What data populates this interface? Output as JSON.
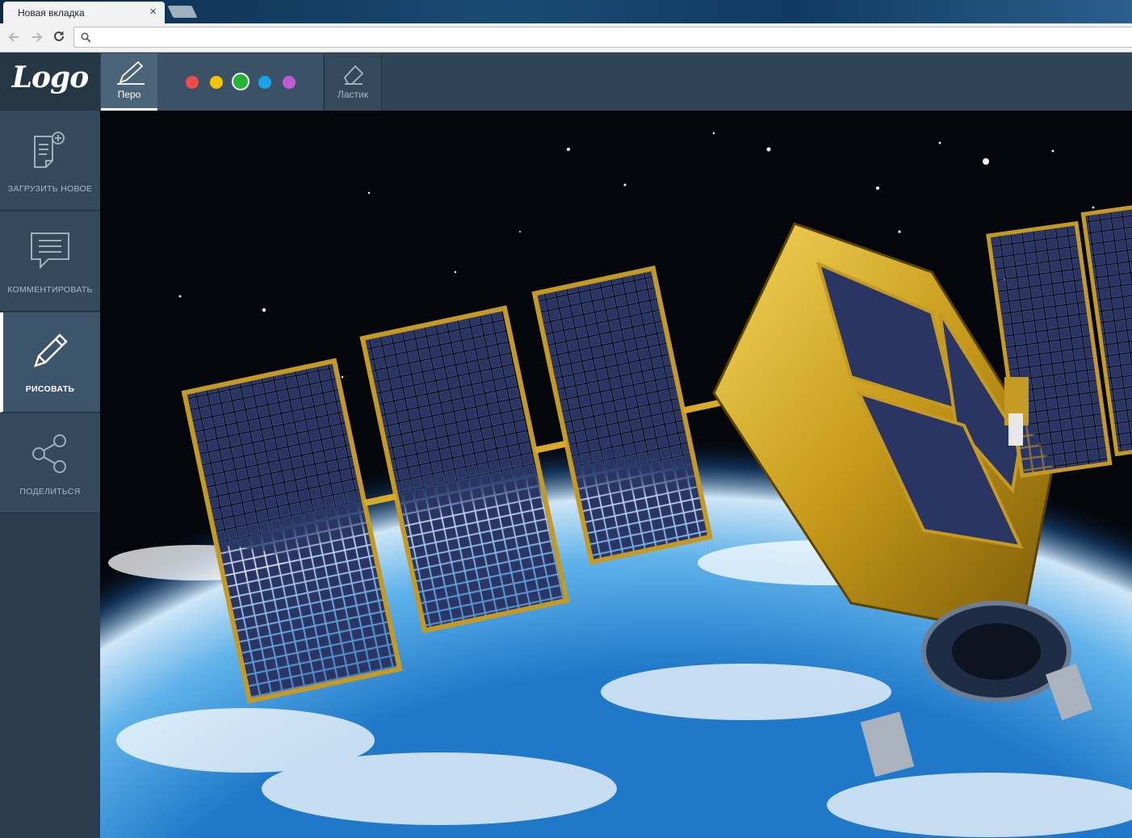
{
  "browser": {
    "tab_title": "Новая вкладка",
    "tab_close": "×",
    "address_value": "",
    "address_placeholder": ""
  },
  "app": {
    "logo_text": "Logo",
    "sidebar": {
      "items": [
        {
          "label": "ЗАГРУЗИТЬ НОВОЕ",
          "icon": "upload-document-icon",
          "active": false
        },
        {
          "label": "КОММЕНТИРОВАТЬ",
          "icon": "comment-icon",
          "active": false
        },
        {
          "label": "РИСОВАТЬ",
          "icon": "pencil-icon",
          "active": true
        },
        {
          "label": "ПОДЕЛИТЬСЯ",
          "icon": "share-icon",
          "active": false
        }
      ]
    },
    "tools": {
      "pen_label": "Перо",
      "eraser_label": "Ластик",
      "colors": [
        {
          "name": "red",
          "hex": "#f04a4a",
          "selected": false
        },
        {
          "name": "yellow",
          "hex": "#f5c400",
          "selected": false
        },
        {
          "name": "green",
          "hex": "#22b52f",
          "selected": true
        },
        {
          "name": "blue",
          "hex": "#1aa3e8",
          "selected": false
        },
        {
          "name": "purple",
          "hex": "#c05ad8",
          "selected": false
        }
      ]
    },
    "canvas": {
      "image_subject": "satellite-in-orbit-image"
    }
  }
}
